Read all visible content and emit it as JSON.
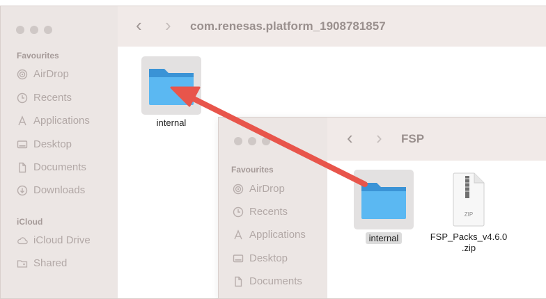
{
  "back_window": {
    "path_title": "com.renesas.platform_1908781857",
    "sidebar": {
      "sections": [
        {
          "label": "Favourites",
          "items": [
            {
              "label": "AirDrop",
              "icon": "airdrop-icon"
            },
            {
              "label": "Recents",
              "icon": "clock-icon"
            },
            {
              "label": "Applications",
              "icon": "applications-icon"
            },
            {
              "label": "Desktop",
              "icon": "desktop-icon"
            },
            {
              "label": "Documents",
              "icon": "document-icon"
            },
            {
              "label": "Downloads",
              "icon": "download-icon"
            }
          ]
        },
        {
          "label": "iCloud",
          "items": [
            {
              "label": "iCloud Drive",
              "icon": "cloud-icon"
            },
            {
              "label": "Shared",
              "icon": "shared-folder-icon"
            }
          ]
        }
      ]
    },
    "content": {
      "items": [
        {
          "label": "internal",
          "type": "folder"
        }
      ]
    }
  },
  "front_window": {
    "path_title": "FSP",
    "sidebar": {
      "sections": [
        {
          "label": "Favourites",
          "items": [
            {
              "label": "AirDrop",
              "icon": "airdrop-icon"
            },
            {
              "label": "Recents",
              "icon": "clock-icon"
            },
            {
              "label": "Applications",
              "icon": "applications-icon"
            },
            {
              "label": "Desktop",
              "icon": "desktop-icon"
            },
            {
              "label": "Documents",
              "icon": "document-icon"
            }
          ]
        }
      ]
    },
    "content": {
      "items": [
        {
          "label": "internal",
          "type": "folder",
          "selected": true
        },
        {
          "label": "FSP_Packs_v4.6.0\n.zip",
          "type": "zip",
          "badge": "ZIP"
        }
      ]
    }
  },
  "annotation": {
    "type": "arrow",
    "color": "#e8554b"
  },
  "colors": {
    "folder_blue": "#5bb8f2",
    "folder_dark": "#3a93d6",
    "arrow": "#e8554b"
  }
}
